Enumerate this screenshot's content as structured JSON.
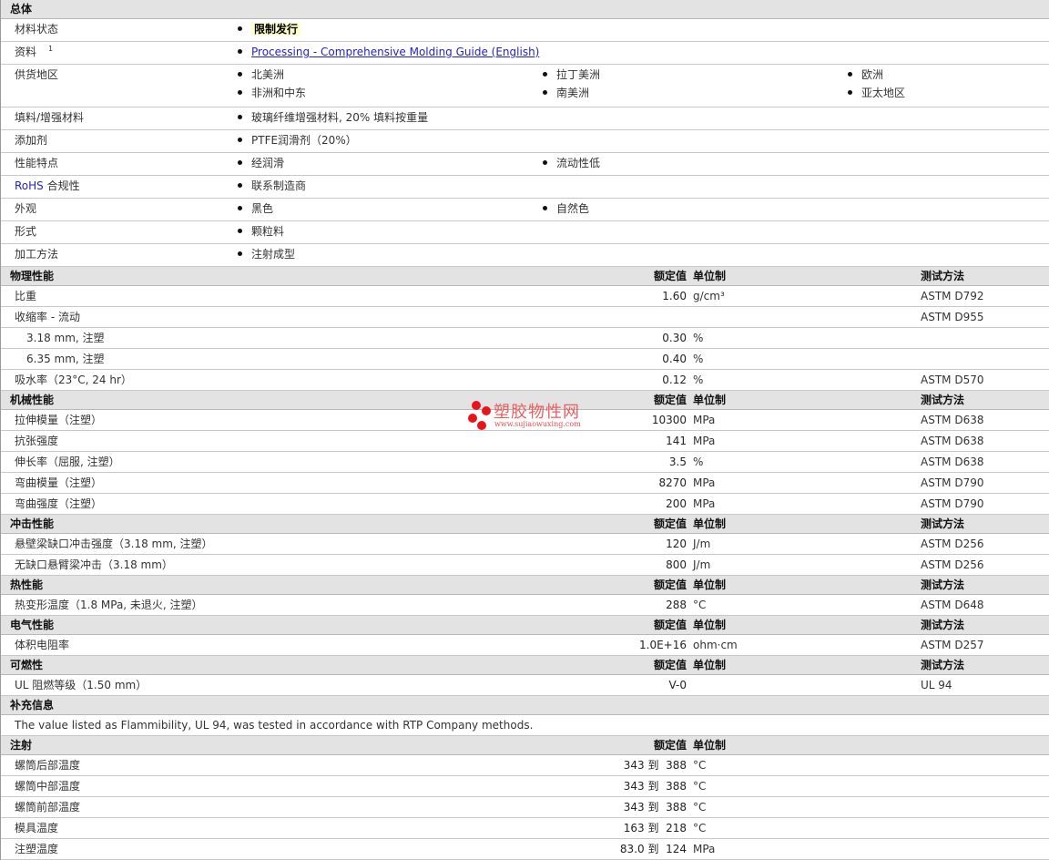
{
  "general": {
    "title": "总体",
    "rows": [
      {
        "label": "材料状态",
        "items": [
          {
            "text": "限制发行",
            "highlight": true
          }
        ]
      },
      {
        "label": "资料",
        "sup": "1",
        "items": [
          {
            "text": "Processing - Comprehensive Molding Guide (English)",
            "link": true
          }
        ]
      },
      {
        "label": "供货地区",
        "items": [
          {
            "text": "北美洲"
          },
          {
            "text": "拉丁美洲"
          },
          {
            "text": "欧洲"
          },
          {
            "text": "非洲和中东"
          },
          {
            "text": "南美洲"
          },
          {
            "text": "亚太地区"
          }
        ]
      },
      {
        "label": "填料/增强材料",
        "items": [
          {
            "text": "玻璃纤维增强材料, 20% 填料按重量"
          }
        ]
      },
      {
        "label": "添加剂",
        "items": [
          {
            "text": "PTFE润滑剂（20%）"
          }
        ]
      },
      {
        "label": "性能特点",
        "items": [
          {
            "text": "经润滑"
          },
          {
            "text": "流动性低"
          }
        ]
      },
      {
        "label": "RoHS 合规性",
        "items": [
          {
            "text": "联系制造商"
          }
        ]
      },
      {
        "label": "外观",
        "items": [
          {
            "text": "黑色"
          },
          {
            "text": "自然色"
          }
        ]
      },
      {
        "label": "形式",
        "items": [
          {
            "text": "颗粒料"
          }
        ]
      },
      {
        "label": "加工方法",
        "items": [
          {
            "text": "注射成型"
          }
        ]
      }
    ]
  },
  "col_headers": {
    "value": "额定值",
    "unit": "单位制",
    "test": "测试方法"
  },
  "sections": [
    {
      "title": "物理性能",
      "test": true,
      "rows": [
        {
          "label": "比重",
          "value": "1.60",
          "unit": "g/cm³",
          "test": "ASTM D792"
        },
        {
          "label": "收缩率 - 流动",
          "value": "",
          "unit": "",
          "test": "ASTM D955"
        },
        {
          "label": "3.18 mm, 注塑",
          "indent": true,
          "value": "0.30",
          "unit": "%",
          "test": ""
        },
        {
          "label": "6.35 mm, 注塑",
          "indent": true,
          "value": "0.40",
          "unit": "%",
          "test": ""
        },
        {
          "label": "吸水率（23°C, 24 hr）",
          "value": "0.12",
          "unit": "%",
          "test": "ASTM D570"
        }
      ]
    },
    {
      "title": "机械性能",
      "test": true,
      "rows": [
        {
          "label": "拉伸模量（注塑）",
          "value": "10300",
          "unit": "MPa",
          "test": "ASTM D638"
        },
        {
          "label": "抗张强度",
          "value": "141",
          "unit": "MPa",
          "test": "ASTM D638"
        },
        {
          "label": "伸长率（屈服, 注塑）",
          "value": "3.5",
          "unit": "%",
          "test": "ASTM D638"
        },
        {
          "label": "弯曲模量（注塑）",
          "value": "8270",
          "unit": "MPa",
          "test": "ASTM D790"
        },
        {
          "label": "弯曲强度（注塑）",
          "value": "200",
          "unit": "MPa",
          "test": "ASTM D790"
        }
      ]
    },
    {
      "title": "冲击性能",
      "test": true,
      "rows": [
        {
          "label": "悬壁梁缺口冲击强度（3.18 mm, 注塑）",
          "value": "120",
          "unit": "J/m",
          "test": "ASTM D256"
        },
        {
          "label": "无缺口悬臂梁冲击（3.18 mm）",
          "value": "800",
          "unit": "J/m",
          "test": "ASTM D256"
        }
      ]
    },
    {
      "title": "热性能",
      "test": true,
      "rows": [
        {
          "label": "热变形温度（1.8 MPa, 未退火, 注塑）",
          "value": "288",
          "unit": "°C",
          "test": "ASTM D648"
        }
      ]
    },
    {
      "title": "电气性能",
      "test": true,
      "rows": [
        {
          "label": "体积电阻率",
          "value": "1.0E+16",
          "unit": "ohm·cm",
          "test": "ASTM D257"
        }
      ]
    },
    {
      "title": "可燃性",
      "test": true,
      "rows": [
        {
          "label": "UL 阻燃等级（1.50 mm）",
          "value": "V-0",
          "unit": "",
          "test": "UL 94"
        }
      ]
    },
    {
      "title": "补充信息",
      "noCols": true,
      "rows": [
        {
          "note": "The value listed as Flammibility, UL 94, was tested in accordance with RTP Company methods."
        }
      ]
    },
    {
      "title": "注射",
      "test": false,
      "rows": [
        {
          "label": "螺筒后部温度",
          "value": "343 到  388",
          "unit": "°C"
        },
        {
          "label": "螺筒中部温度",
          "value": "343 到  388",
          "unit": "°C"
        },
        {
          "label": "螺筒前部温度",
          "value": "343 到  388",
          "unit": "°C"
        },
        {
          "label": "模具温度",
          "value": "163 到  218",
          "unit": "°C"
        },
        {
          "label": "注塑温度",
          "value": "83.0 到  124",
          "unit": "MPa"
        }
      ]
    }
  ],
  "watermark": {
    "name": "塑胶物性网",
    "url": "www.sujiaowuxing.com"
  }
}
